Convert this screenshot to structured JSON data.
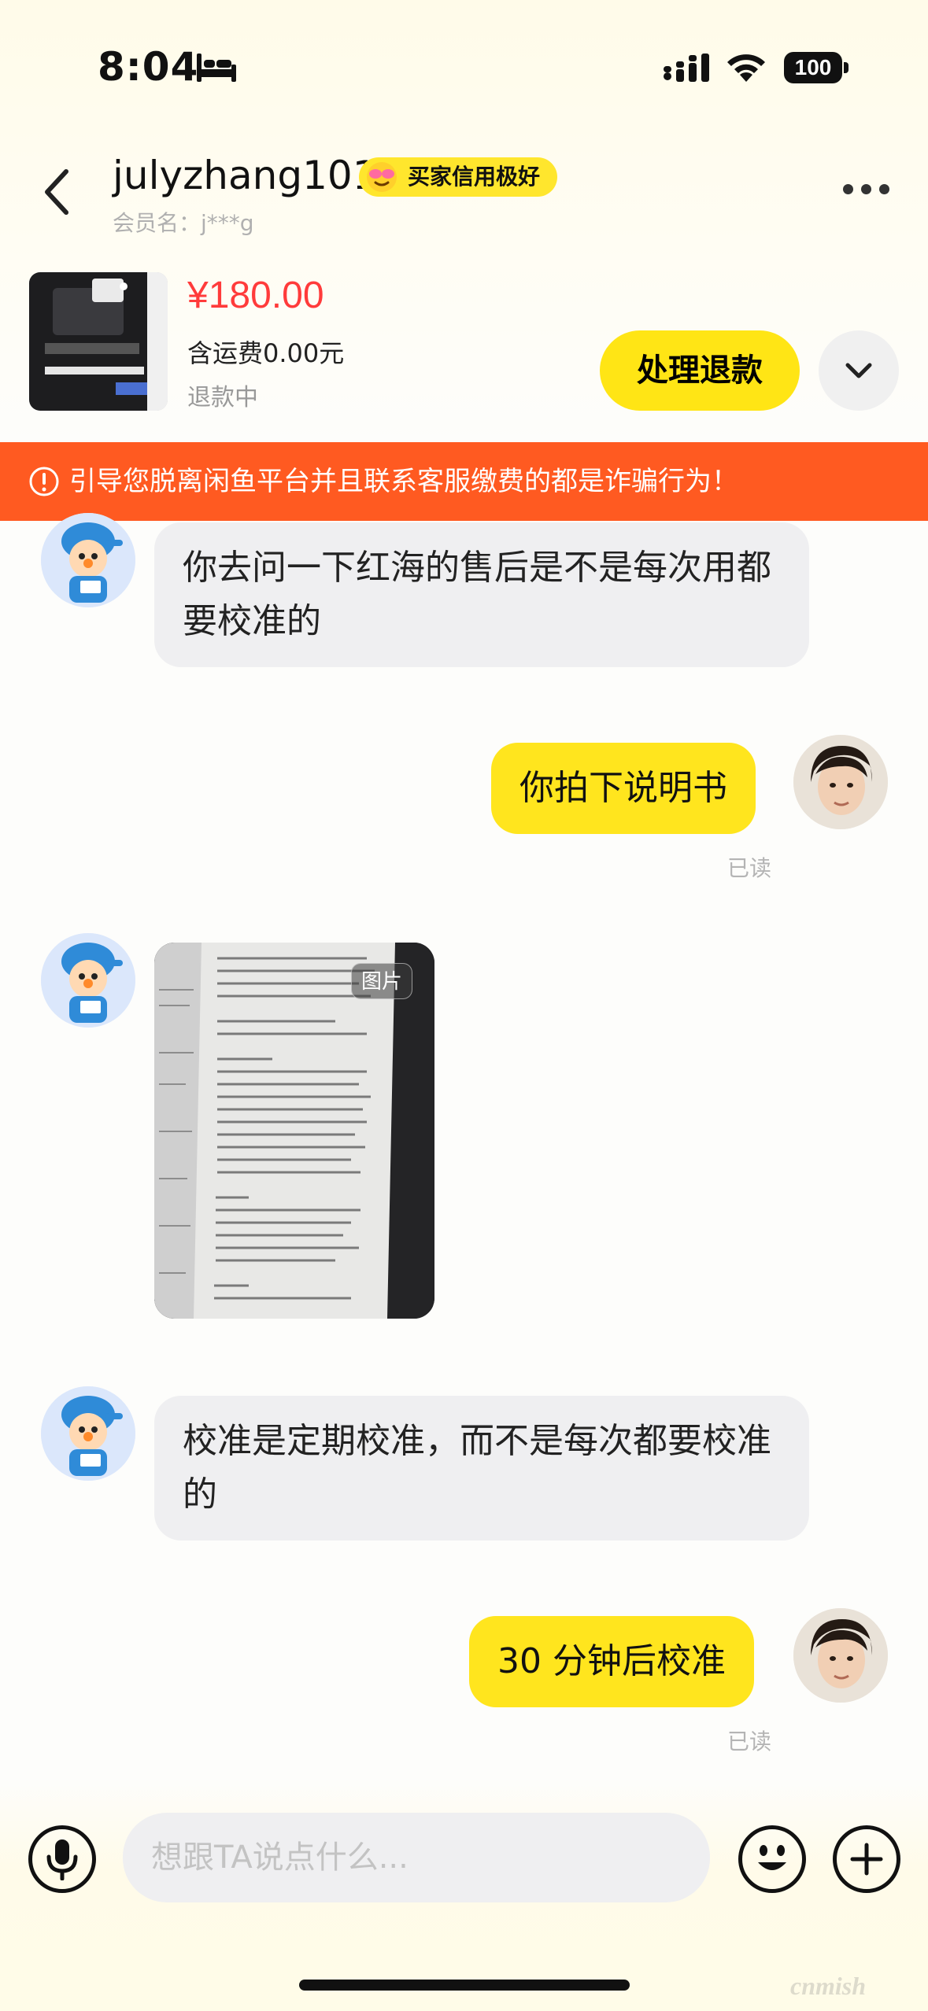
{
  "status_bar": {
    "time": "8:04",
    "battery": "100"
  },
  "header": {
    "title": "julyzhang101",
    "badge": "买家信用极好",
    "member_label": "会员名：j***g"
  },
  "product": {
    "price": "¥180.00",
    "shipping": "含运费0.00元",
    "status": "退款中",
    "action_label": "处理退款"
  },
  "warning": "引导您脱离闲鱼平台并且联系客服缴费的都是诈骗行为！",
  "messages": [
    {
      "side": "in",
      "text": "你去问一下红海的售后是不是每次用都要校准的"
    },
    {
      "side": "out",
      "text": "你拍下说明书",
      "status": "已读"
    },
    {
      "side": "in",
      "type": "image",
      "tag": "图片"
    },
    {
      "side": "in",
      "text": "校准是定期校准，而不是每次都要校准的"
    },
    {
      "side": "out",
      "text": "30 分钟后校准",
      "status": "已读"
    }
  ],
  "input": {
    "placeholder": "想跟TA说点什么..."
  },
  "watermark": "cnmish"
}
